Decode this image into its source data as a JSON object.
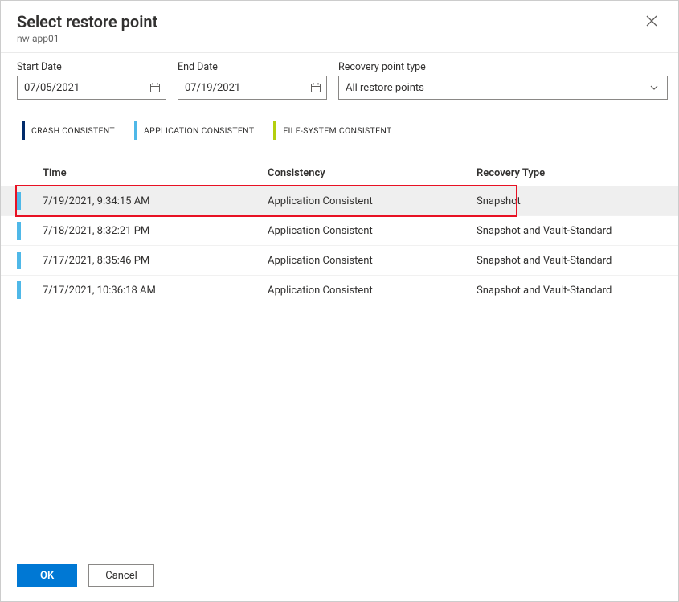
{
  "dialog": {
    "title": "Select restore point",
    "resource_name": "nw-app01"
  },
  "filters": {
    "start_date_label": "Start Date",
    "start_date_value": "07/05/2021",
    "end_date_label": "End Date",
    "end_date_value": "07/19/2021",
    "recovery_type_label": "Recovery point type",
    "recovery_type_value": "All restore points"
  },
  "legend": {
    "crash": "CRASH CONSISTENT",
    "application": "APPLICATION CONSISTENT",
    "file": "FILE-SYSTEM CONSISTENT"
  },
  "columns": {
    "time": "Time",
    "consistency": "Consistency",
    "recovery_type": "Recovery Type"
  },
  "rows": [
    {
      "time": "7/19/2021, 9:34:15 AM",
      "consistency": "Application Consistent",
      "recovery_type": "Snapshot",
      "highlighted": true,
      "selected": true
    },
    {
      "time": "7/18/2021, 8:32:21 PM",
      "consistency": "Application Consistent",
      "recovery_type": "Snapshot and Vault-Standard"
    },
    {
      "time": "7/17/2021, 8:35:46 PM",
      "consistency": "Application Consistent",
      "recovery_type": "Snapshot and Vault-Standard"
    },
    {
      "time": "7/17/2021, 10:36:18 AM",
      "consistency": "Application Consistent",
      "recovery_type": "Snapshot and Vault-Standard"
    }
  ],
  "buttons": {
    "ok": "OK",
    "cancel": "Cancel"
  },
  "colors": {
    "primary": "#0078d4",
    "legend_crash": "#012b6b",
    "legend_application": "#4fb8e8",
    "legend_file": "#b4cf0e",
    "annotation": "#e81123"
  }
}
